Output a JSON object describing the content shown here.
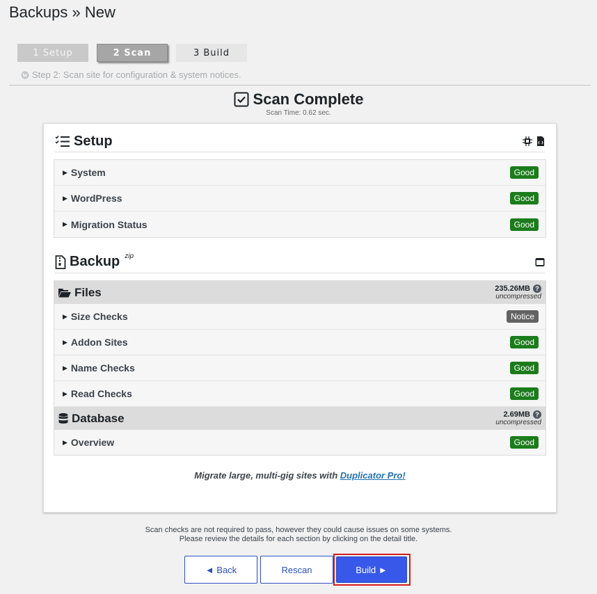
{
  "page": {
    "title": "Backups » New"
  },
  "steps": [
    {
      "label": "1 Setup"
    },
    {
      "label": "2 Scan"
    },
    {
      "label": "3 Build"
    }
  ],
  "step_description": "Step 2: Scan site for configuration & system notices.",
  "scan": {
    "title": "Scan Complete",
    "time": "Scan Time: 0.62 sec."
  },
  "setup": {
    "title": "Setup",
    "items": [
      {
        "label": "System",
        "status": "Good"
      },
      {
        "label": "WordPress",
        "status": "Good"
      },
      {
        "label": "Migration Status",
        "status": "Good"
      }
    ]
  },
  "backup": {
    "title": "Backup",
    "format": "zip",
    "files": {
      "title": "Files",
      "size": "235.26MB",
      "size_note": "uncompressed",
      "items": [
        {
          "label": "Size Checks",
          "status": "Notice"
        },
        {
          "label": "Addon Sites",
          "status": "Good"
        },
        {
          "label": "Name Checks",
          "status": "Good"
        },
        {
          "label": "Read Checks",
          "status": "Good"
        }
      ]
    },
    "database": {
      "title": "Database",
      "size": "2.69MB",
      "size_note": "uncompressed",
      "items": [
        {
          "label": "Overview",
          "status": "Good"
        }
      ]
    }
  },
  "promo": {
    "text": "Migrate large, multi-gig sites with ",
    "link": "Duplicator Pro!"
  },
  "footnote": {
    "line1": "Scan checks are not required to pass, however they could cause issues on some systems.",
    "line2": "Please review the details for each section by clicking on the detail title."
  },
  "buttons": {
    "back": "◄ Back",
    "rescan": "Rescan",
    "build": "Build ►"
  },
  "colors": {
    "good": "#1c7c1c",
    "notice": "#636363",
    "primary": "#3858e9",
    "highlight": "#d21d1d"
  }
}
